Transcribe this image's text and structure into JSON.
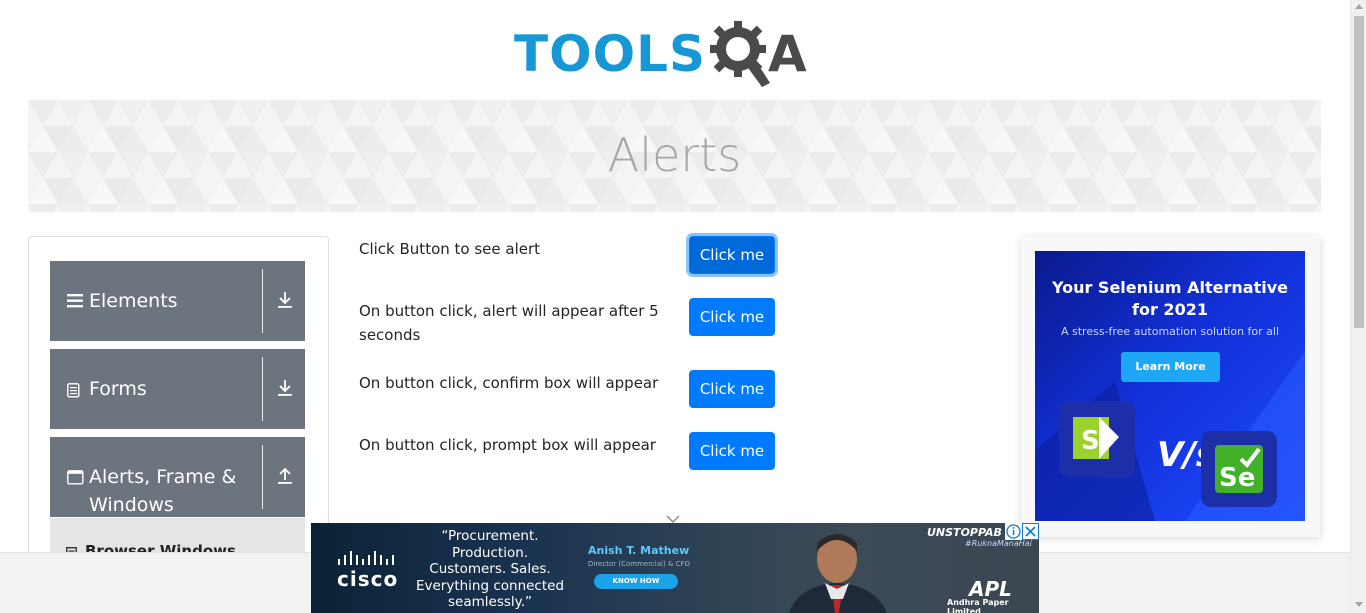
{
  "header": {
    "logo_text": "TOOLS",
    "logo_suffix": "A",
    "brand_color": "#1797d6",
    "logo_icon": "gear-magnifier-icon"
  },
  "banner": {
    "title": "Alerts"
  },
  "sidebar": {
    "groups": [
      {
        "label": "Elements",
        "icon": "hamburger-icon",
        "toggle_icon": "download-arrow-icon"
      },
      {
        "label": "Forms",
        "icon": "document-icon",
        "toggle_icon": "download-arrow-icon"
      },
      {
        "label_line1": "Alerts, Frame &",
        "label_line2": "Windows",
        "icon": "window-icon",
        "toggle_icon": "upload-arrow-icon"
      }
    ],
    "subitems": [
      {
        "label": "Browser Windows",
        "icon": "list-icon"
      }
    ],
    "group_color": "#6c757d"
  },
  "alerts": {
    "rows": [
      {
        "text": "Click Button to see alert",
        "button": "Click me"
      },
      {
        "text_line1": "On button click, alert will appear after 5",
        "text_line2": "seconds",
        "button": "Click me"
      },
      {
        "text": "On button click, confirm box will appear",
        "button": "Click me"
      },
      {
        "text": "On button click, prompt box will appear",
        "button": "Click me"
      }
    ],
    "button_color": "#007bff"
  },
  "right_ad": {
    "title_line1": "Your Selenium Alternative",
    "title_line2": "for 2021",
    "subtitle": "A stress-free automation solution for all",
    "button": "Learn More",
    "vs_text": "V/s",
    "logo_left_letter": "S",
    "logo_right_text": "Se"
  },
  "bottom_ad": {
    "brand": "cisco",
    "quote_lines": [
      "“Procurement.",
      "Production.",
      "Customers. Sales.",
      "Everything connected",
      "seamlessly.”"
    ],
    "person_name": "Anish T. Mathew",
    "person_title": "Director (Commercial) & CFO",
    "cta": "KNOW HOW",
    "campaign": "UNSTOPPAB",
    "hashtag": "#RuknaManaHai",
    "company_logo": "APL",
    "company_name": "Andhra Paper Limited",
    "info_icon": "info-icon",
    "close_icon": "close-icon"
  }
}
